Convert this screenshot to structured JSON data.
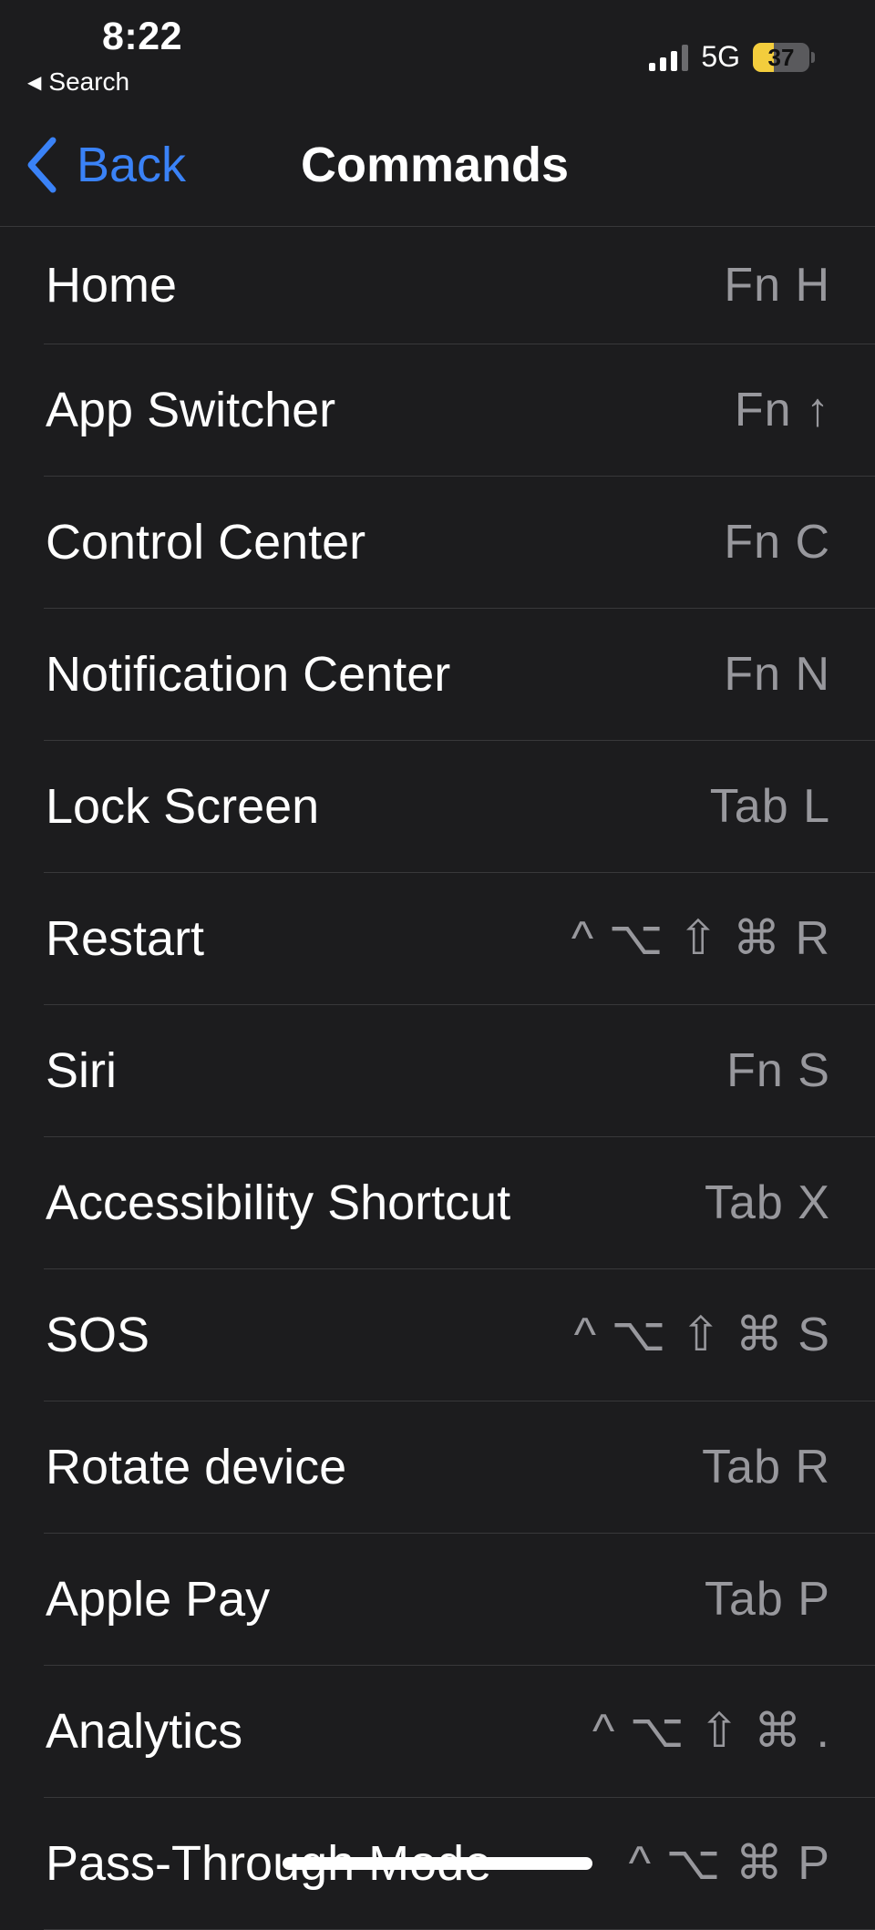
{
  "status_bar": {
    "time": "8:22",
    "back_app_label": "Search",
    "network": "5G",
    "battery_percent": 37,
    "battery_label": "37",
    "battery_color": "#f3cd3d"
  },
  "nav": {
    "back_label": "Back",
    "title": "Commands",
    "accent_color": "#3a82f7"
  },
  "commands": [
    {
      "label": "Home",
      "shortcut": "Fn H"
    },
    {
      "label": "App Switcher",
      "shortcut": "Fn ↑"
    },
    {
      "label": "Control Center",
      "shortcut": "Fn C"
    },
    {
      "label": "Notification Center",
      "shortcut": "Fn N"
    },
    {
      "label": "Lock Screen",
      "shortcut": "Tab L"
    },
    {
      "label": "Restart",
      "shortcut": "^ ⌥ ⇧ ⌘ R"
    },
    {
      "label": "Siri",
      "shortcut": "Fn S"
    },
    {
      "label": "Accessibility Shortcut",
      "shortcut": "Tab X"
    },
    {
      "label": "SOS",
      "shortcut": "^ ⌥ ⇧ ⌘ S"
    },
    {
      "label": "Rotate device",
      "shortcut": "Tab R"
    },
    {
      "label": "Apple Pay",
      "shortcut": "Tab P"
    },
    {
      "label": "Analytics",
      "shortcut": "^ ⌥ ⇧ ⌘ ."
    },
    {
      "label": "Pass-Through Mode",
      "shortcut": "^ ⌥ ⌘ P"
    }
  ]
}
